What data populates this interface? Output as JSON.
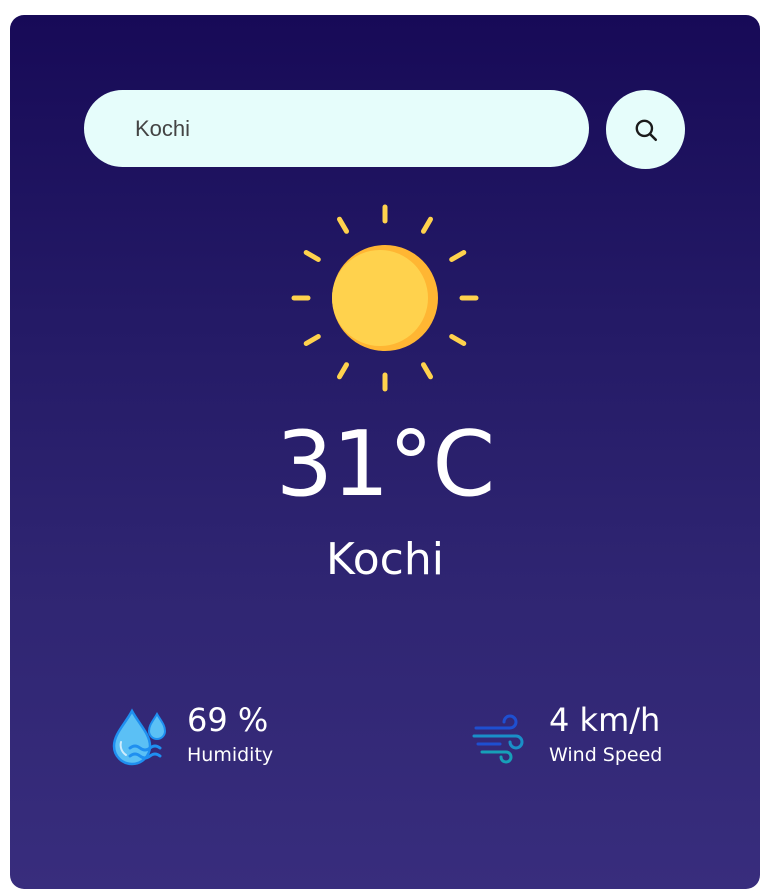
{
  "search": {
    "value": "Kochi",
    "placeholder": "Kochi",
    "button_icon": "search-icon"
  },
  "weather": {
    "icon": "sun-icon",
    "temperature": "31°C",
    "city": "Kochi"
  },
  "humidity": {
    "icon": "humidity-drops-icon",
    "value": "69 %",
    "label": "Humidity"
  },
  "wind": {
    "icon": "wind-icon",
    "value": "4 km/h",
    "label": "Wind Speed"
  },
  "colors": {
    "card_top": "#170a57",
    "card_bottom": "#382d7d",
    "search_bg": "#e6fdfb",
    "sun": "#ffd24d",
    "text": "#ffffff"
  }
}
